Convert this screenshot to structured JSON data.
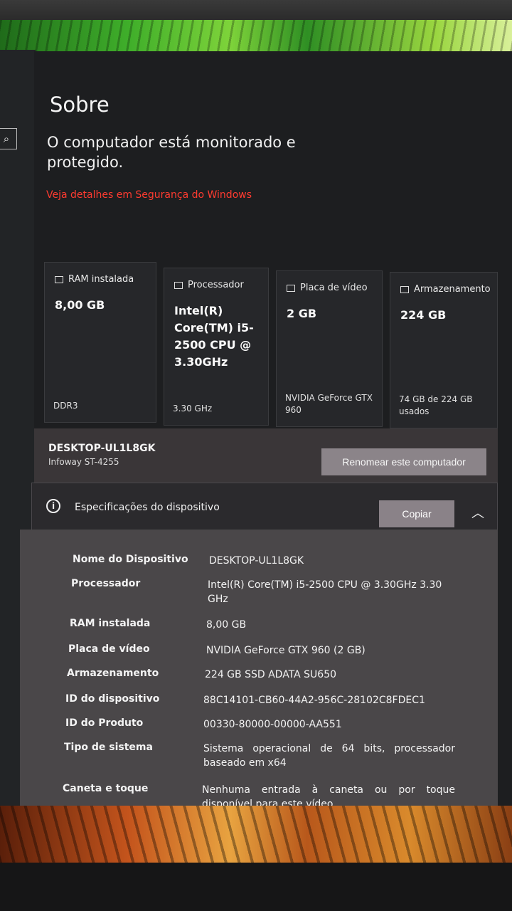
{
  "page": {
    "title": "Sobre",
    "subtitle": "O computador está monitorado e protegido.",
    "security_link": "Veja detalhes em Segurança do Windows"
  },
  "cards": [
    {
      "label": "RAM instalada",
      "value": "8,00 GB",
      "foot": "DDR3",
      "icon": "ram-icon"
    },
    {
      "label": "Processador",
      "value": "Intel(R) Core(TM) i5-2500 CPU @ 3.30GHz",
      "foot": "3.30 GHz",
      "icon": "processor-icon"
    },
    {
      "label": "Placa de vídeo",
      "value": "2 GB",
      "foot": "NVIDIA GeForce GTX 960",
      "icon": "gpu-icon"
    },
    {
      "label": "Armazenamento",
      "value": "224 GB",
      "foot": "74 GB de 224 GB usados",
      "icon": "storage-icon"
    }
  ],
  "computer": {
    "name": "DESKTOP-UL1L8GK",
    "model": "Infoway ST-4255",
    "rename_label": "Renomear este computador"
  },
  "specs": {
    "title": "Especificações do dispositivo",
    "copy_label": "Copiar",
    "rows": [
      {
        "label": "Nome do Dispositivo",
        "value": "DESKTOP-UL1L8GK"
      },
      {
        "label": "Processador",
        "value": "Intel(R) Core(TM) i5-2500 CPU @ 3.30GHz   3.30 GHz"
      },
      {
        "label": "RAM instalada",
        "value": "8,00 GB"
      },
      {
        "label": "Placa de vídeo",
        "value": "NVIDIA GeForce GTX 960 (2 GB)"
      },
      {
        "label": "Armazenamento",
        "value": "224 GB SSD ADATA SU650"
      },
      {
        "label": "ID do dispositivo",
        "value": "88C14101-CB60-44A2-956C-28102C8FDEC1"
      },
      {
        "label": "ID do Produto",
        "value": "00330-80000-00000-AA551"
      },
      {
        "label": "Tipo de sistema",
        "value": "Sistema operacional de 64 bits, processador baseado em x64"
      },
      {
        "label": "Caneta e toque",
        "value": "Nenhuma entrada à caneta ou por toque disponível para este vídeo"
      }
    ]
  }
}
